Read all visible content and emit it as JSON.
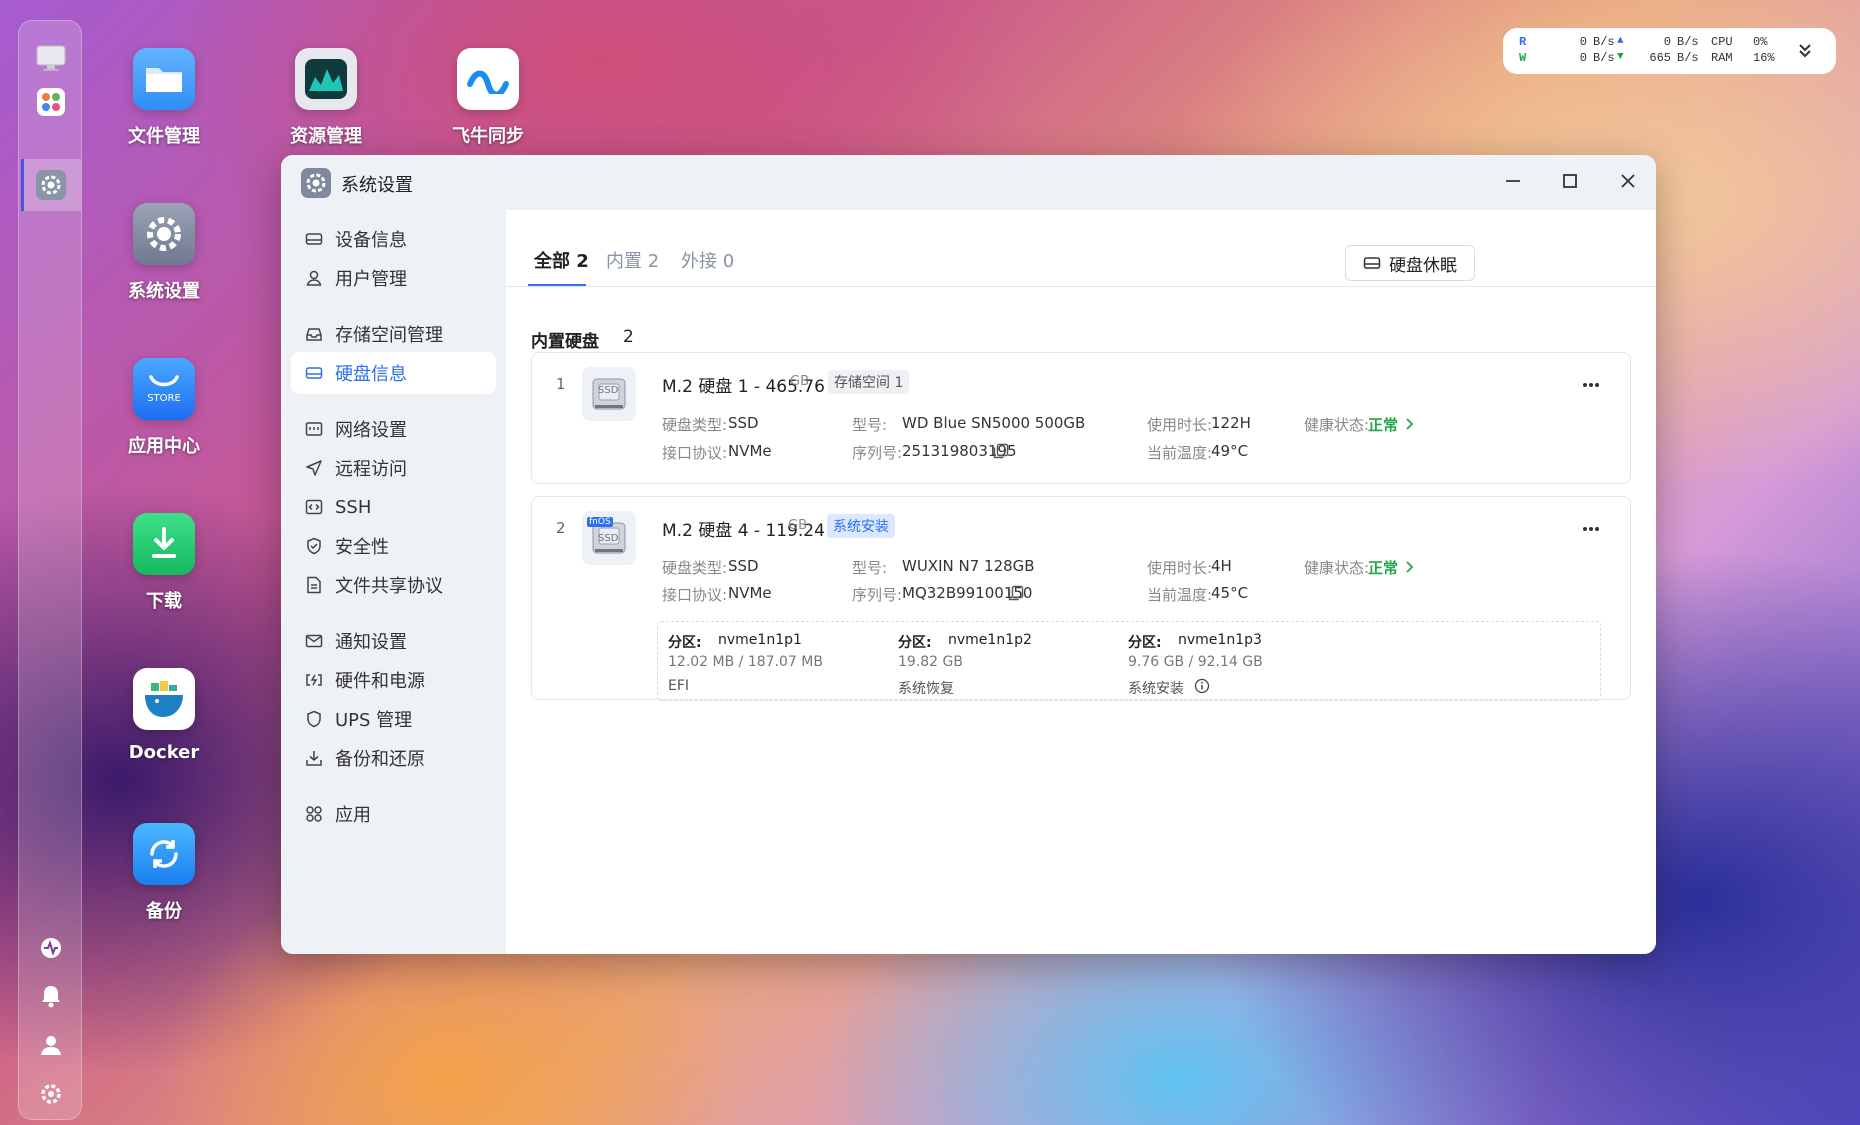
{
  "desktop": {
    "apps": [
      {
        "label": "文件管理",
        "icon": "folder-icon"
      },
      {
        "label": "资源管理",
        "icon": "monitor-chart-icon"
      },
      {
        "label": "飞牛同步",
        "icon": "sync-icon"
      },
      {
        "label": "系统设置",
        "icon": "gear-icon"
      },
      {
        "label": "应用中心",
        "icon": "store-icon",
        "badge_text": "STORE"
      },
      {
        "label": "下载",
        "icon": "download-icon"
      },
      {
        "label": "Docker",
        "icon": "docker-icon"
      },
      {
        "label": "备份",
        "icon": "backup-icon"
      }
    ]
  },
  "monitor": {
    "r": "R",
    "w": "W",
    "r_value": "0",
    "r_unit": "B/s",
    "w_value": "0",
    "w_unit": "B/s",
    "up_value": "0",
    "up_unit": "B/s",
    "down_value": "665",
    "down_unit": "B/s",
    "cpu_label": "CPU",
    "cpu_value": "0%",
    "ram_label": "RAM",
    "ram_value": "16%"
  },
  "window": {
    "title": "系统设置"
  },
  "sidebar": {
    "items": [
      {
        "label": "设备信息"
      },
      {
        "label": "用户管理"
      },
      {
        "label": "存储空间管理"
      },
      {
        "label": "硬盘信息"
      },
      {
        "label": "网络设置"
      },
      {
        "label": "远程访问"
      },
      {
        "label": "SSH"
      },
      {
        "label": "安全性"
      },
      {
        "label": "文件共享协议"
      },
      {
        "label": "通知设置"
      },
      {
        "label": "硬件和电源"
      },
      {
        "label": "UPS 管理"
      },
      {
        "label": "备份和还原"
      },
      {
        "label": "应用"
      }
    ],
    "active": "硬盘信息"
  },
  "tabs": [
    {
      "label": "全部 2"
    },
    {
      "label": "内置 2"
    },
    {
      "label": "外接 0"
    }
  ],
  "sleep_button": "硬盘休眠",
  "section": {
    "title": "内置硬盘",
    "count": "2"
  },
  "labels": {
    "type": "硬盘类型:",
    "interface": "接口协议:",
    "model": "型号:",
    "serial": "序列号:",
    "usage": "使用时长:",
    "temp": "当前温度:",
    "health": "健康状态:",
    "partition": "分区:"
  },
  "disks": [
    {
      "index": "1",
      "name": "M.2 硬盘 1 - 465.76",
      "unit": "GB",
      "badge": "存储空间 1",
      "type": "SSD",
      "interface": "NVMe",
      "model": "WD Blue SN5000 500GB",
      "serial": "251319803195",
      "usage": "122H",
      "temp": "49°C",
      "health": "正常",
      "icon_text": "SSD"
    },
    {
      "index": "2",
      "name": "M.2 硬盘 4 - 119.24",
      "unit": "GB",
      "badge": "系统安装",
      "type": "SSD",
      "interface": "NVMe",
      "model": "WUXIN N7 128GB",
      "serial": "MQ32B99100150",
      "usage": "4H",
      "temp": "45°C",
      "health": "正常",
      "icon_text": "SSD",
      "icon_brand": "fnOS",
      "partitions": [
        {
          "name": "nvme1n1p1",
          "size": "12.02 MB / 187.07 MB",
          "purpose": "EFI"
        },
        {
          "name": "nvme1n1p2",
          "size": "19.82 GB",
          "purpose": "系统恢复"
        },
        {
          "name": "nvme1n1p3",
          "size": "9.76 GB / 92.14 GB",
          "purpose": "系统安装"
        }
      ]
    }
  ],
  "colors": {
    "accent": "#2f6ff0",
    "healthy": "#1fa84a",
    "badge_blue_bg": "#dbe8ff"
  }
}
